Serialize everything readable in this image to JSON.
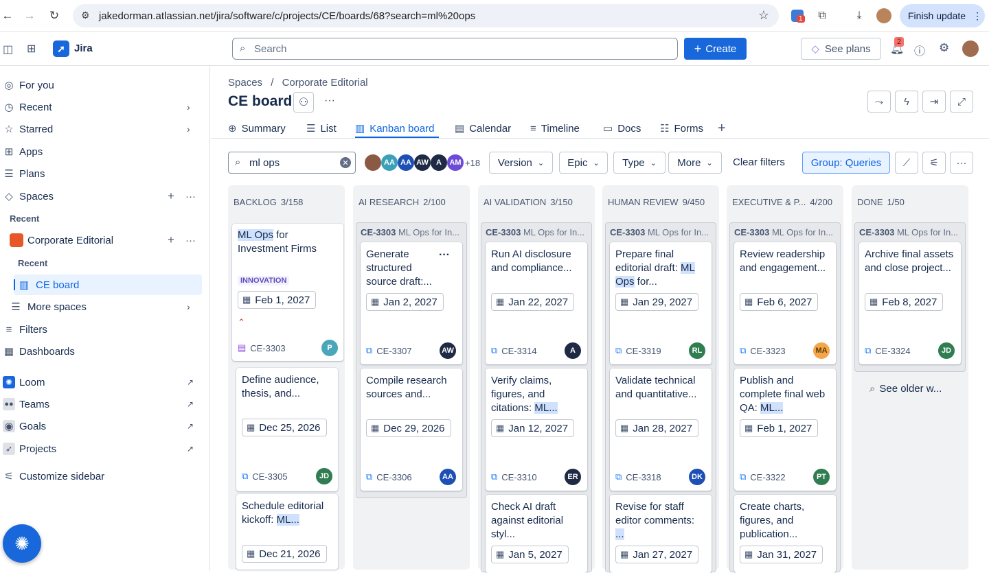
{
  "browser": {
    "url": "jakedorman.atlassian.net/jira/software/c/projects/CE/boards/68?search=ml%20ops",
    "finish_update": "Finish update",
    "ext_badge": "1"
  },
  "topbar": {
    "app_name": "Jira",
    "search_placeholder": "Search",
    "create_label": "Create",
    "see_plans": "See plans",
    "notif_count": "2"
  },
  "sidebar": {
    "for_you": "For you",
    "recent": "Recent",
    "starred": "Starred",
    "apps": "Apps",
    "plans": "Plans",
    "spaces": "Spaces",
    "recent_section": "Recent",
    "corporate_editorial": "Corporate Editorial",
    "recent_sub": "Recent",
    "ce_board": "CE board",
    "more_spaces": "More spaces",
    "filters": "Filters",
    "dashboards": "Dashboards",
    "loom": "Loom",
    "teams": "Teams",
    "goals": "Goals",
    "projects": "Projects",
    "customize": "Customize sidebar"
  },
  "breadcrumb": {
    "spaces": "Spaces",
    "sep": "/",
    "project": "Corporate Editorial"
  },
  "page": {
    "title": "CE board",
    "more": "···"
  },
  "tabs": [
    "Summary",
    "List",
    "Kanban board",
    "Calendar",
    "Timeline",
    "Docs",
    "Forms"
  ],
  "filters": {
    "search_value": "ml ops",
    "avatars": [
      "AA",
      "AA",
      "AW",
      "A",
      "AM"
    ],
    "avatar_more": "+18",
    "version": "Version",
    "epic": "Epic",
    "type": "Type",
    "more": "More",
    "clear": "Clear filters",
    "group": "Group: Queries"
  },
  "colors": {
    "accent": "#0c66e4",
    "selected_bg": "#e9f2ff"
  },
  "columns": [
    {
      "name": "BACKLOG",
      "count": "3/158"
    },
    {
      "name": "AI RESEARCH",
      "count": "2/100"
    },
    {
      "name": "AI VALIDATION",
      "count": "3/150"
    },
    {
      "name": "HUMAN REVIEW",
      "count": "9/450"
    },
    {
      "name": "EXECUTIVE & P...",
      "count": "4/200"
    },
    {
      "name": "DONE",
      "count": "1/50"
    }
  ],
  "group_head": {
    "key": "CE-3303",
    "text": "ML Ops for In..."
  },
  "backlog": {
    "parent": {
      "t1": "ML Ops",
      "t2": " for Investment Firms",
      "tag": "INNOVATION",
      "date": "Feb 1, 2027",
      "key": "CE-3303",
      "avatar": "P"
    },
    "cards": [
      {
        "title": "Define audience, thesis, and...",
        "date": "Dec 25, 2026",
        "key": "CE-3305",
        "avatar": "JD"
      },
      {
        "title": "Schedule editorial kickoff: ",
        "hl": "ML...",
        "date": "Dec 21, 2026"
      }
    ]
  },
  "research": {
    "cards": [
      {
        "title": "Generate structured source draft:...",
        "date": "Jan 2, 2027",
        "key": "CE-3307",
        "avatar": "AW",
        "more": "···"
      },
      {
        "title": "Compile research sources and...",
        "date": "Dec 29, 2026",
        "key": "CE-3306",
        "avatar": "AA"
      }
    ]
  },
  "validation": {
    "cards": [
      {
        "title": "Run AI disclosure and compliance...",
        "date": "Jan 22, 2027",
        "key": "CE-3314",
        "avatar": "A"
      },
      {
        "title": "Verify claims, figures, and citations: ",
        "hl": "ML...",
        "date": "Jan 12, 2027",
        "key": "CE-3310",
        "avatar": "ER"
      },
      {
        "title": "Check AI draft against editorial styl...",
        "date": "Jan 5, 2027"
      }
    ]
  },
  "review": {
    "cards": [
      {
        "title": "Prepare final editorial draft: ",
        "hl": "ML Ops",
        "tail": " for...",
        "date": "Jan 29, 2027",
        "key": "CE-3319",
        "avatar": "RL"
      },
      {
        "title": "Validate technical and quantitative...",
        "date": "Jan 28, 2027",
        "key": "CE-3318",
        "avatar": "DK"
      },
      {
        "title": "Revise for staff editor comments: ",
        "hl": "...",
        "date": "Jan 27, 2027"
      }
    ]
  },
  "executive": {
    "cards": [
      {
        "title": "Review readership and engagement...",
        "date": "Feb 6, 2027",
        "key": "CE-3323",
        "avatar": "MA"
      },
      {
        "title": "Publish and complete final web QA: ",
        "hl": "ML...",
        "date": "Feb 1, 2027",
        "key": "CE-3322",
        "avatar": "PT"
      },
      {
        "title": "Create charts, figures, and publication...",
        "date": "Jan 31, 2027"
      }
    ]
  },
  "done": {
    "cards": [
      {
        "title": "Archive final assets and close project...",
        "date": "Feb 8, 2027",
        "key": "CE-3324",
        "avatar": "JD"
      }
    ],
    "see_older": "See older w..."
  }
}
